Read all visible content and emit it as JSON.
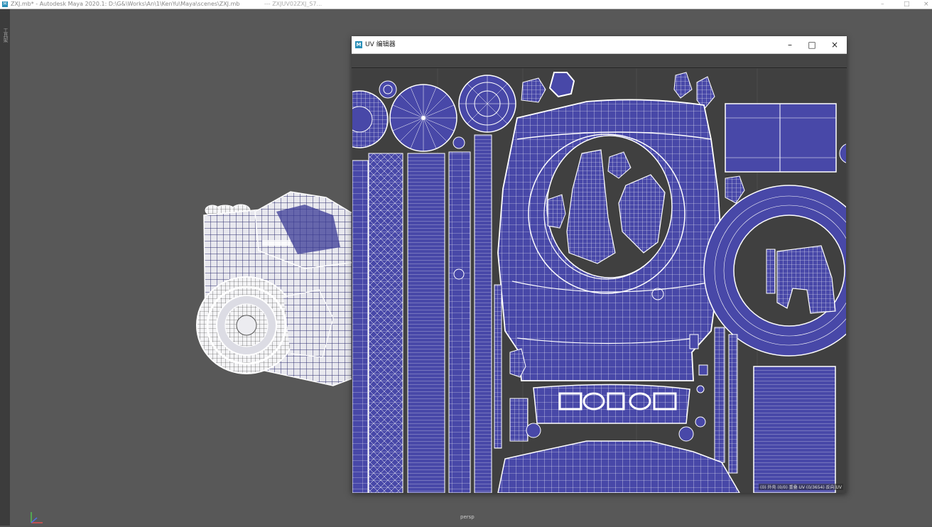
{
  "app_window": {
    "title": "ZXJ.mb* - Autodesk Maya 2020.1: D:\\G&\\Works\\An\\1\\KenYu\\Maya\\scenes\\ZXJ.mb",
    "title_extra": "---   ZXJUV02ZXJ_S7...",
    "logo": "M",
    "controls": {
      "minimize": "–",
      "maximize": "□",
      "close": "×"
    }
  },
  "side_strip": {
    "text": "工具架"
  },
  "viewport": {
    "camera_label": "persp",
    "axis_icon": "xyz-axis-icon"
  },
  "uv_editor": {
    "logo": "M",
    "title": "UV 编辑器",
    "controls": {
      "minimize": "–",
      "maximize": "□",
      "close": "×"
    },
    "status": "(0) 外壳 (0/0) 重叠 UV (0/3654) 反向 UV",
    "colors": {
      "shell_fill": "#4848a8",
      "wireframe": "#ffffff",
      "background": "#404040"
    }
  }
}
